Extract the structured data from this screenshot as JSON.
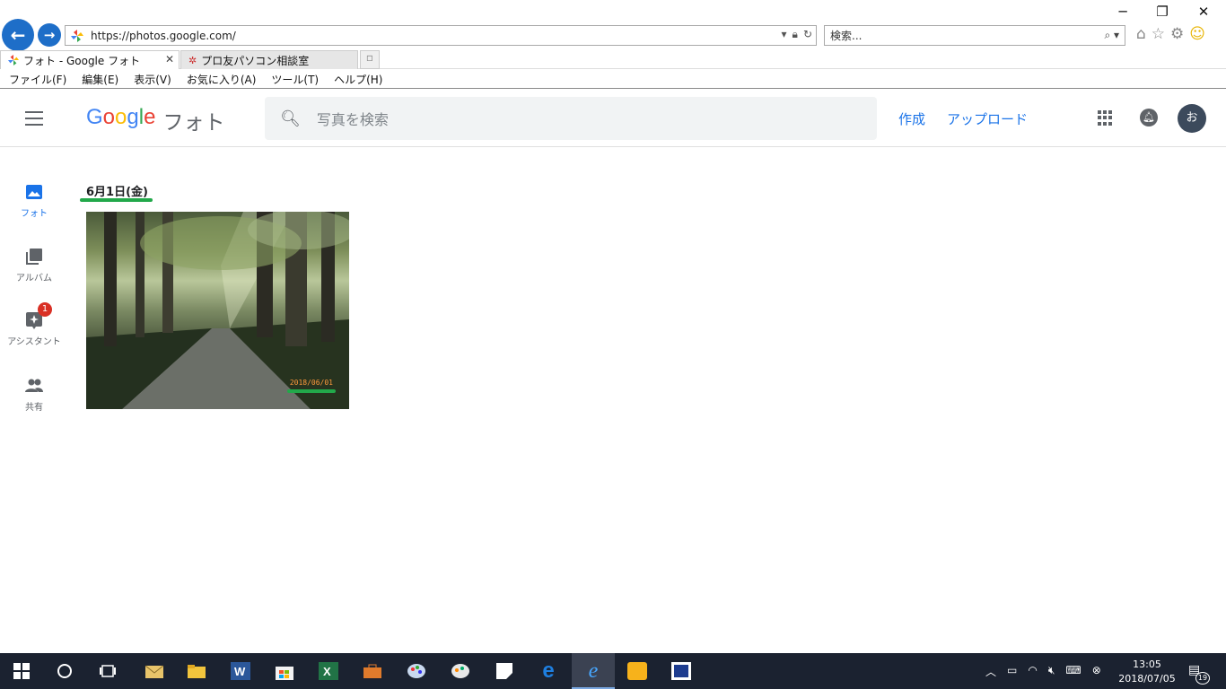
{
  "browser": {
    "url": "https://photos.google.com/",
    "search_placeholder": "検索...",
    "tabs": [
      {
        "label": "フォト - Google フォト"
      },
      {
        "label": "プロ友パソコン相談室"
      }
    ],
    "menu": [
      "ファイル(F)",
      "編集(E)",
      "表示(V)",
      "お気に入り(A)",
      "ツール(T)",
      "ヘルプ(H)"
    ]
  },
  "app": {
    "logo_product": "フォト",
    "search_placeholder": "写真を検索",
    "create_label": "作成",
    "upload_label": "アップロード",
    "avatar_letter": "お"
  },
  "nav": {
    "photos": "フォト",
    "albums": "アルバム",
    "assistant": "アシスタント",
    "assistant_badge": "1",
    "sharing": "共有"
  },
  "main": {
    "date_label": "6月1日(金)",
    "photo_stamp": "2018/06/01"
  },
  "taskbar": {
    "time": "13:05",
    "date": "2018/07/05",
    "notification_count": "19"
  },
  "colors": {
    "accent": "#1a73e8",
    "highlight": "#22a84a",
    "taskbar": "#1b2230"
  }
}
